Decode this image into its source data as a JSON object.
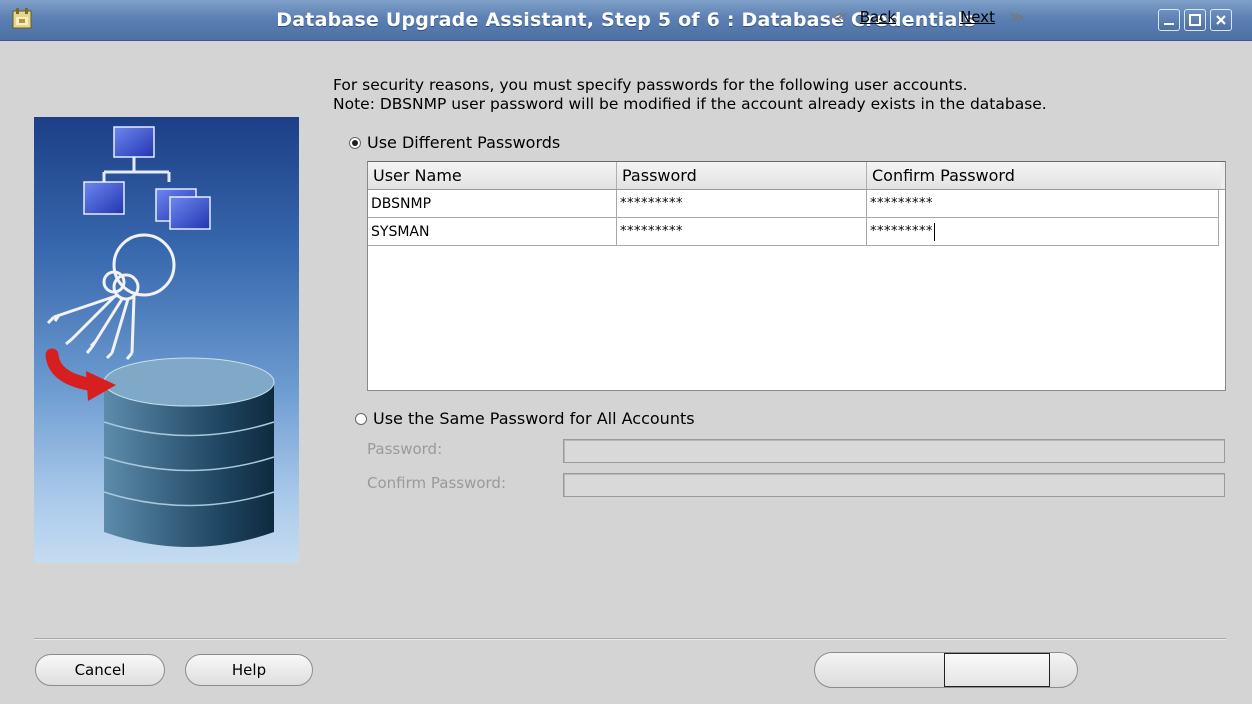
{
  "window": {
    "title": "Database Upgrade Assistant, Step 5 of 6 : Database Credentials"
  },
  "intro": {
    "line1": "For security reasons, you must specify passwords for the following user accounts.",
    "line2": "Note: DBSNMP user password will be modified if the account already exists in the database."
  },
  "options": {
    "different": "Use Different Passwords",
    "same": "Use the Same Password for All Accounts",
    "selected": "different"
  },
  "table": {
    "headers": [
      "User Name",
      "Password",
      "Confirm Password"
    ],
    "rows": [
      {
        "user": "DBSNMP",
        "password": "*********",
        "confirm": "*********"
      },
      {
        "user": "SYSMAN",
        "password": "*********",
        "confirm": "*********"
      }
    ]
  },
  "same_password": {
    "password_label": "Password:",
    "confirm_label": "Confirm Password:"
  },
  "buttons": {
    "cancel": "Cancel",
    "help": "Help",
    "back": "Back",
    "next": "Next"
  },
  "icons": [
    "app-icon",
    "minimize-icon",
    "maximize-icon",
    "close-icon",
    "back-arrow-icon",
    "next-arrow-icon"
  ]
}
